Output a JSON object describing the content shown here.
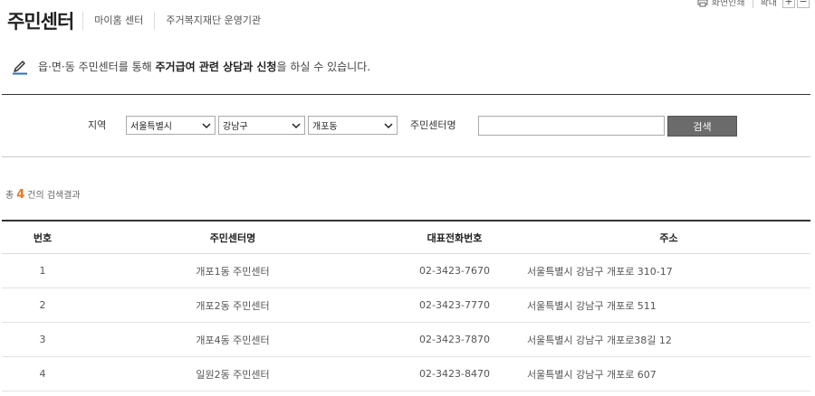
{
  "topbar": {
    "print_label": "화면인쇄",
    "zoom_label": "확대",
    "zoom_in": "+",
    "zoom_out": "−"
  },
  "header": {
    "title": "주민센터",
    "tabs": [
      "마이홈 센터",
      "주거복지재단 운영기관"
    ]
  },
  "intro": {
    "prefix": "읍·면·동 주민센터를 통해 ",
    "strong": "주거급여 관련 상담과 신청",
    "suffix": "을 하실 수 있습니다."
  },
  "search": {
    "region_label": "지역",
    "city_value": "서울특별시",
    "district_value": "강남구",
    "dong_value": "개포동",
    "center_name_label": "주민센터명",
    "center_name_value": "",
    "button_label": "검색"
  },
  "results": {
    "prefix": "총",
    "count": "4",
    "suffix": "건의 검색결과"
  },
  "table": {
    "headers": [
      "번호",
      "주민센터명",
      "대표전화번호",
      "주소"
    ],
    "rows": [
      [
        "1",
        "개포1동 주민센터",
        "02-3423-7670",
        "서울특별시 강남구 개포로 310-17"
      ],
      [
        "2",
        "개포2동 주민센터",
        "02-3423-7770",
        "서울특별시 강남구 개포로 511"
      ],
      [
        "3",
        "개포4동 주민센터",
        "02-3423-7870",
        "서울특별시 강남구 개포로38길 12"
      ],
      [
        "4",
        "일원2동 주민센터",
        "02-3423-8470",
        "서울특별시 강남구 개포로 607"
      ]
    ]
  },
  "icons": {
    "print": "printer-icon",
    "edit": "pencil-icon",
    "dropdown": "chevron-down-icon"
  },
  "colors": {
    "accent_orange": "#e8761d",
    "button_gray": "#6b6b6b",
    "pencil_blue": "#2d6fb5"
  }
}
